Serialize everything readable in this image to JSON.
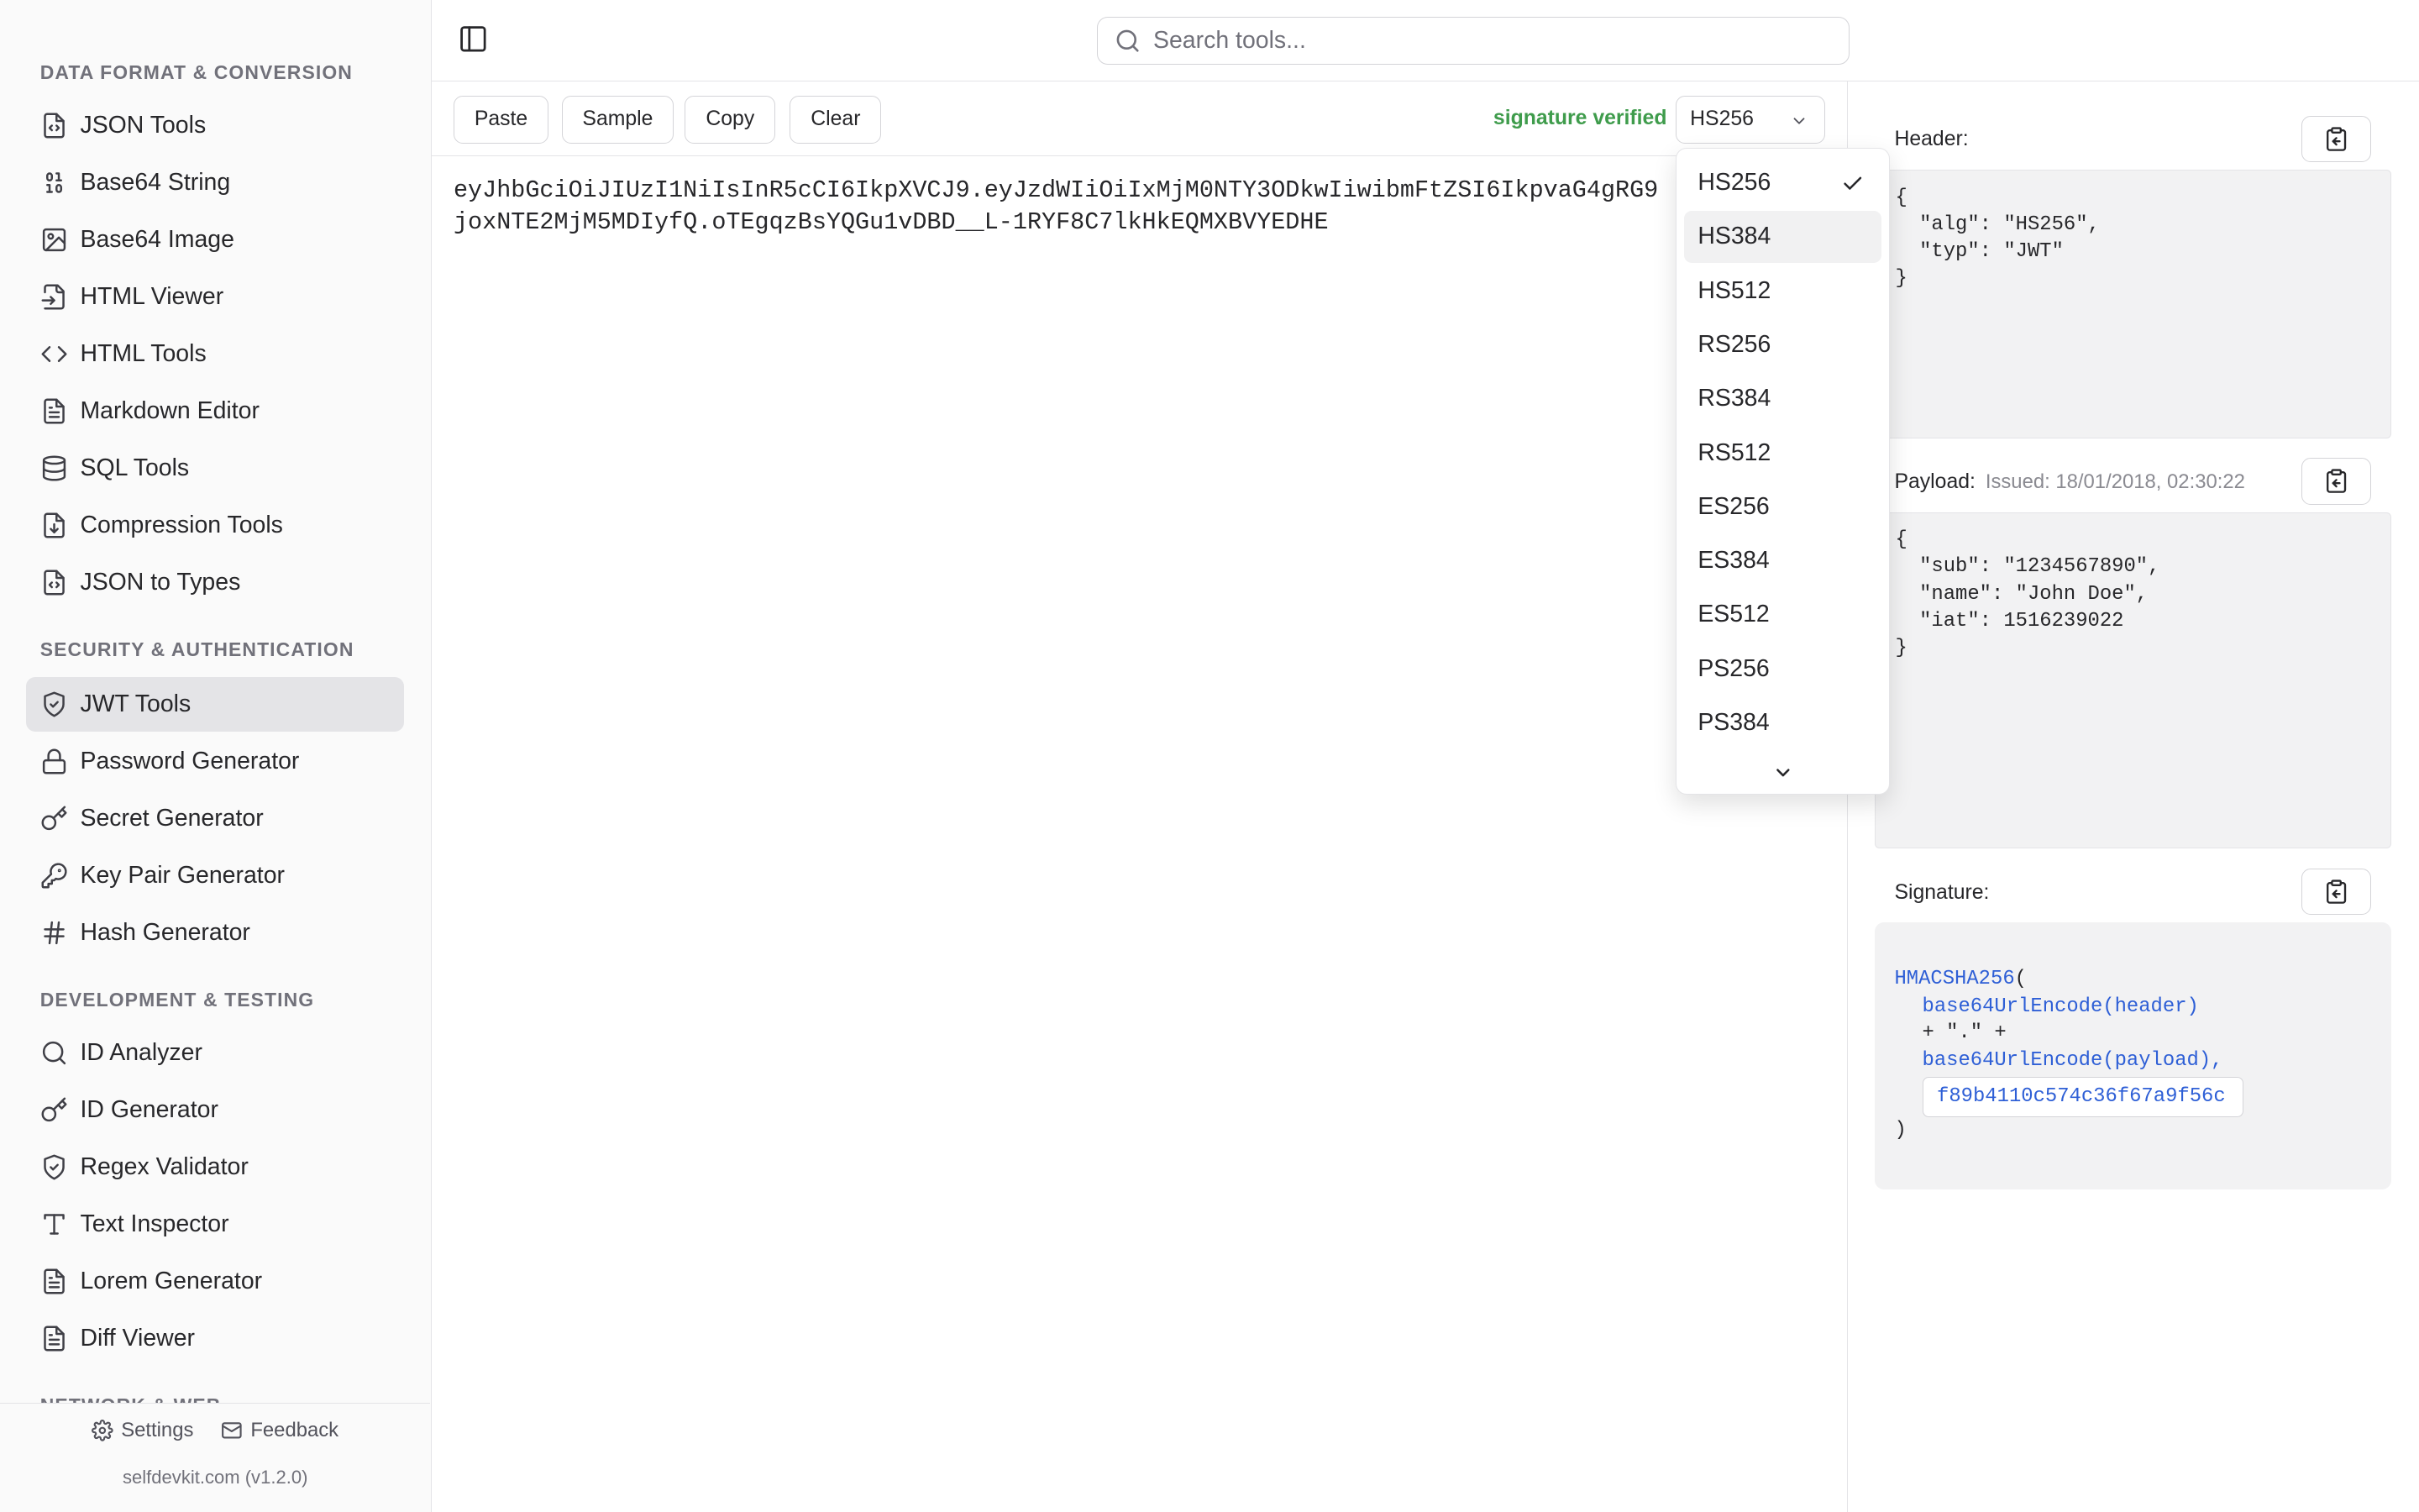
{
  "app": {
    "name": "selfdevkit",
    "version_label": "selfdevkit.com (v1.2.0)"
  },
  "sidebar": {
    "sections": [
      {
        "title": "DATA FORMAT & CONVERSION"
      },
      {
        "title": "SECURITY & AUTHENTICATION"
      },
      {
        "title": "DEVELOPMENT & TESTING"
      },
      {
        "title": "NETWORK & WEB"
      }
    ],
    "items": [
      {
        "label": "JSON Tools",
        "icon": "file-code-icon"
      },
      {
        "label": "Base64 String",
        "icon": "binary-icon"
      },
      {
        "label": "Base64 Image",
        "icon": "image-icon"
      },
      {
        "label": "HTML Viewer",
        "icon": "file-input-icon"
      },
      {
        "label": "HTML Tools",
        "icon": "code-icon"
      },
      {
        "label": "Markdown Editor",
        "icon": "file-text-icon"
      },
      {
        "label": "SQL Tools",
        "icon": "database-icon"
      },
      {
        "label": "Compression Tools",
        "icon": "file-down-icon"
      },
      {
        "label": "JSON to Types",
        "icon": "file-code-icon"
      },
      {
        "label": "JWT Tools",
        "icon": "shield-check-icon",
        "active": true
      },
      {
        "label": "Password Generator",
        "icon": "lock-icon"
      },
      {
        "label": "Secret Generator",
        "icon": "key-round-icon"
      },
      {
        "label": "Key Pair Generator",
        "icon": "key-icon"
      },
      {
        "label": "Hash Generator",
        "icon": "hash-icon"
      },
      {
        "label": "ID Analyzer",
        "icon": "search-icon"
      },
      {
        "label": "ID Generator",
        "icon": "key-round-icon"
      },
      {
        "label": "Regex Validator",
        "icon": "shield-check-icon"
      },
      {
        "label": "Text Inspector",
        "icon": "type-icon"
      },
      {
        "label": "Lorem Generator",
        "icon": "file-text-icon"
      },
      {
        "label": "Diff Viewer",
        "icon": "file-text-icon"
      }
    ],
    "footer": {
      "settings": "Settings",
      "feedback": "Feedback"
    }
  },
  "topbar": {
    "search_placeholder": "Search tools..."
  },
  "editor": {
    "buttons": {
      "paste": "Paste",
      "sample": "Sample",
      "copy": "Copy",
      "clear": "Clear"
    },
    "status": "signature verified",
    "status_color": "#3f9c4c",
    "algorithm": "HS256",
    "token_lines": [
      "eyJhbGciOiJIUzI1NiIsInR5cCI6IkpXVCJ9.eyJzdWIiOiIxMjM0NTY3ODkwIiwibmFtZSI6IkpvaG4gRG9",
      "joxNTE2MjM5MDIyfQ.oTEgqzBsYQGu1vDBD__L-1RYF8C7lkHkEQMXBVYEDHE"
    ]
  },
  "algorithm_dropdown": {
    "options": [
      "HS256",
      "HS384",
      "HS512",
      "RS256",
      "RS384",
      "RS512",
      "ES256",
      "ES384",
      "ES512",
      "PS256",
      "PS384"
    ],
    "selected": "HS256",
    "hovered": "HS384"
  },
  "decoded": {
    "header_label": "Header:",
    "header_json": "{\n  \"alg\": \"HS256\",\n  \"typ\": \"JWT\"\n}",
    "payload_label": "Payload:",
    "issued": "Issued: 18/01/2018, 02:30:22",
    "payload_json": "{\n  \"sub\": \"1234567890\",\n  \"name\": \"John Doe\",\n  \"iat\": 1516239022\n}",
    "signature_label": "Signature:",
    "signature": {
      "func": "HMACSHA256",
      "open_paren": "(",
      "line1": "base64UrlEncode(header)",
      "line2": "+ \".\" +",
      "line3": "base64UrlEncode(payload),",
      "secret": "f89b4110c574c36f67a9f56c",
      "close_paren": ")"
    },
    "accent_color": "#2e5fd6"
  }
}
